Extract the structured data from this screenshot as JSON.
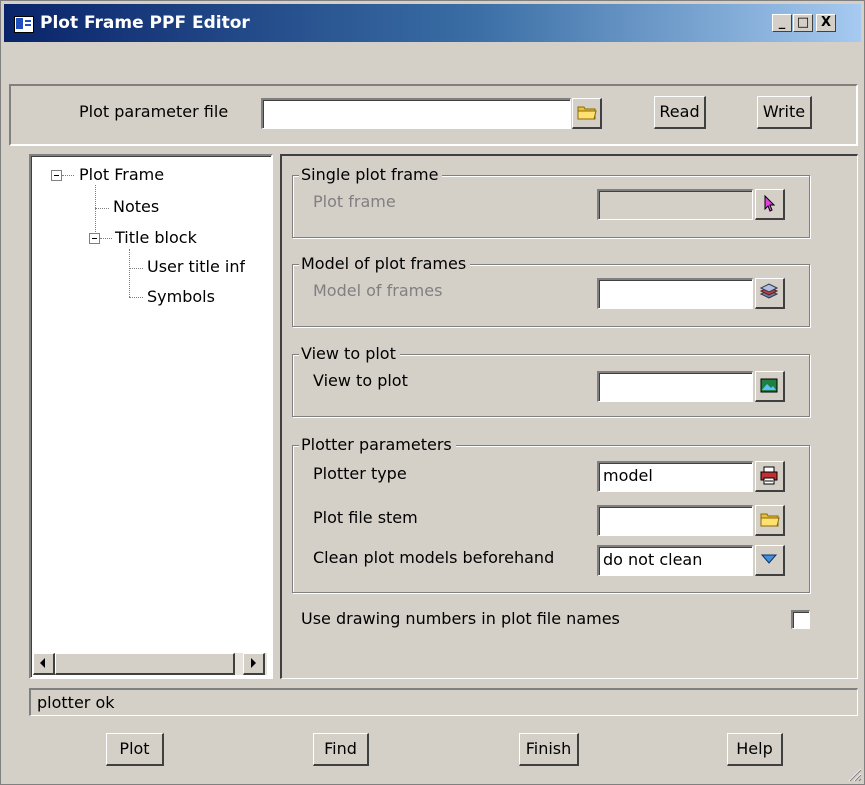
{
  "window": {
    "title": "Plot Frame PPF Editor",
    "minimize": "_",
    "maximize": "□",
    "close": "X"
  },
  "top": {
    "ppf_label": "Plot parameter file",
    "ppf_value": "",
    "read_label": "Read",
    "write_label": "Write"
  },
  "tree": {
    "root": "Plot Frame",
    "items": [
      "Notes",
      "Title block",
      "User title info",
      "Symbols"
    ]
  },
  "single": {
    "title": "Single plot frame",
    "label": "Plot frame",
    "value": ""
  },
  "model": {
    "title": "Model of plot frames",
    "label": "Model of frames",
    "value": ""
  },
  "view": {
    "title": "View to plot",
    "label": "View to plot",
    "value": ""
  },
  "plotter": {
    "title": "Plotter parameters",
    "type_label": "Plotter type",
    "type_value": "model",
    "stem_label": "Plot file stem",
    "stem_value": "",
    "clean_label": "Clean plot models beforehand",
    "clean_value": "do not clean"
  },
  "drawing_numbers_label": "Use drawing numbers in plot file names",
  "drawing_numbers_checked": false,
  "status": "plotter ok",
  "bottom": {
    "plot": "Plot",
    "find": "Find",
    "finish": "Finish",
    "help": "Help"
  }
}
